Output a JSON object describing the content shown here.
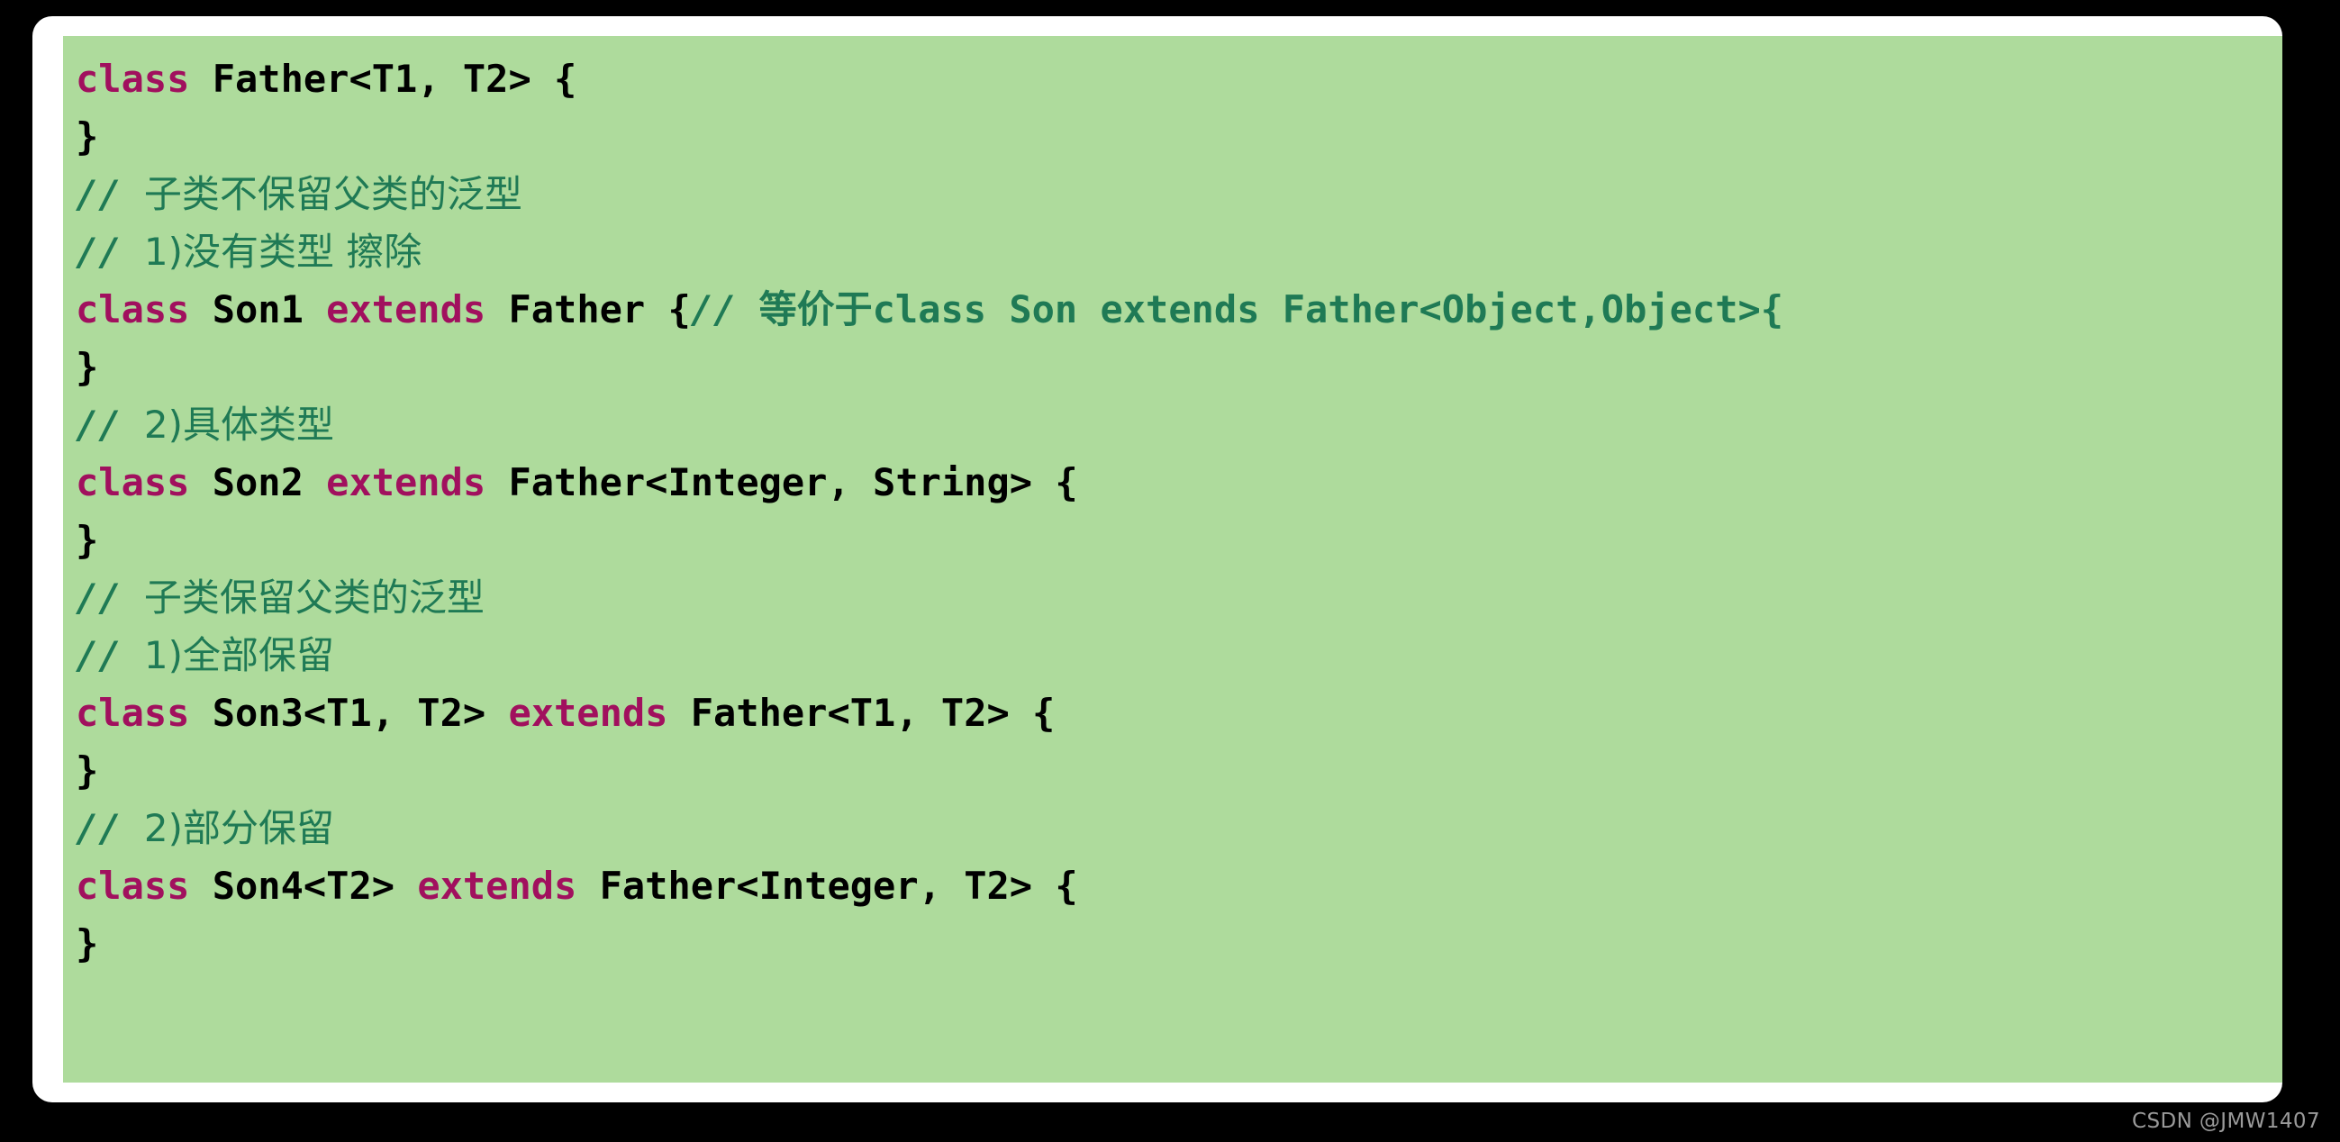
{
  "colors": {
    "page_background": "#000000",
    "frame": "#ffffff",
    "code_background": "#aedb9c",
    "keyword": "#a1105e",
    "identifier": "#000000",
    "comment": "#1f7a55",
    "watermark": "#9a9a9a"
  },
  "code_block": {
    "language": "java",
    "lines": [
      {
        "id": "line-1",
        "tokens": [
          {
            "kind": "keyword",
            "text": "class"
          },
          {
            "kind": "plain",
            "text": " Father<T1, T2> {"
          }
        ]
      },
      {
        "id": "line-2",
        "tokens": [
          {
            "kind": "plain",
            "text": "}"
          }
        ]
      },
      {
        "id": "line-3",
        "cn": true,
        "tokens": [
          {
            "kind": "comment",
            "text": "// "
          },
          {
            "kind": "comment-cn",
            "text": "子类不保留父类的泛型"
          }
        ]
      },
      {
        "id": "line-4",
        "cn": true,
        "tokens": [
          {
            "kind": "comment",
            "text": "// "
          },
          {
            "kind": "comment-cn",
            "text": "1)没有类型 擦除"
          }
        ]
      },
      {
        "id": "line-5",
        "tokens": [
          {
            "kind": "keyword",
            "text": "class"
          },
          {
            "kind": "plain",
            "text": " Son1 "
          },
          {
            "kind": "keyword",
            "text": "extends"
          },
          {
            "kind": "plain",
            "text": " Father {"
          },
          {
            "kind": "comment",
            "text": "// "
          },
          {
            "kind": "comment-cn",
            "text": "等价于"
          },
          {
            "kind": "comment-code",
            "text": "class Son extends Father<Object,Object>{"
          }
        ]
      },
      {
        "id": "line-6",
        "tokens": [
          {
            "kind": "plain",
            "text": "}"
          }
        ]
      },
      {
        "id": "line-7",
        "cn": true,
        "tokens": [
          {
            "kind": "comment",
            "text": "// "
          },
          {
            "kind": "comment-cn",
            "text": "2)具体类型"
          }
        ]
      },
      {
        "id": "line-8",
        "tokens": [
          {
            "kind": "keyword",
            "text": "class"
          },
          {
            "kind": "plain",
            "text": " Son2 "
          },
          {
            "kind": "keyword",
            "text": "extends"
          },
          {
            "kind": "plain",
            "text": " Father<Integer, String> {"
          }
        ]
      },
      {
        "id": "line-9",
        "tokens": [
          {
            "kind": "plain",
            "text": "}"
          }
        ]
      },
      {
        "id": "line-10",
        "cn": true,
        "tokens": [
          {
            "kind": "comment",
            "text": "// "
          },
          {
            "kind": "comment-cn",
            "text": "子类保留父类的泛型"
          }
        ]
      },
      {
        "id": "line-11",
        "cn": true,
        "tokens": [
          {
            "kind": "comment",
            "text": "// "
          },
          {
            "kind": "comment-cn",
            "text": "1)全部保留"
          }
        ]
      },
      {
        "id": "line-12",
        "tokens": [
          {
            "kind": "keyword",
            "text": "class"
          },
          {
            "kind": "plain",
            "text": " Son3<T1, T2> "
          },
          {
            "kind": "keyword",
            "text": "extends"
          },
          {
            "kind": "plain",
            "text": " Father<T1, T2> {"
          }
        ]
      },
      {
        "id": "line-13",
        "tokens": [
          {
            "kind": "plain",
            "text": "}"
          }
        ]
      },
      {
        "id": "line-14",
        "cn": true,
        "tokens": [
          {
            "kind": "comment",
            "text": "// "
          },
          {
            "kind": "comment-cn",
            "text": "2)部分保留"
          }
        ]
      },
      {
        "id": "line-15",
        "tokens": [
          {
            "kind": "keyword",
            "text": "class"
          },
          {
            "kind": "plain",
            "text": " Son4<T2> "
          },
          {
            "kind": "keyword",
            "text": "extends"
          },
          {
            "kind": "plain",
            "text": " Father<Integer, T2> {"
          }
        ]
      },
      {
        "id": "line-16",
        "tokens": [
          {
            "kind": "plain",
            "text": "}"
          }
        ]
      }
    ]
  },
  "watermark": {
    "text": "CSDN @JMW1407"
  }
}
